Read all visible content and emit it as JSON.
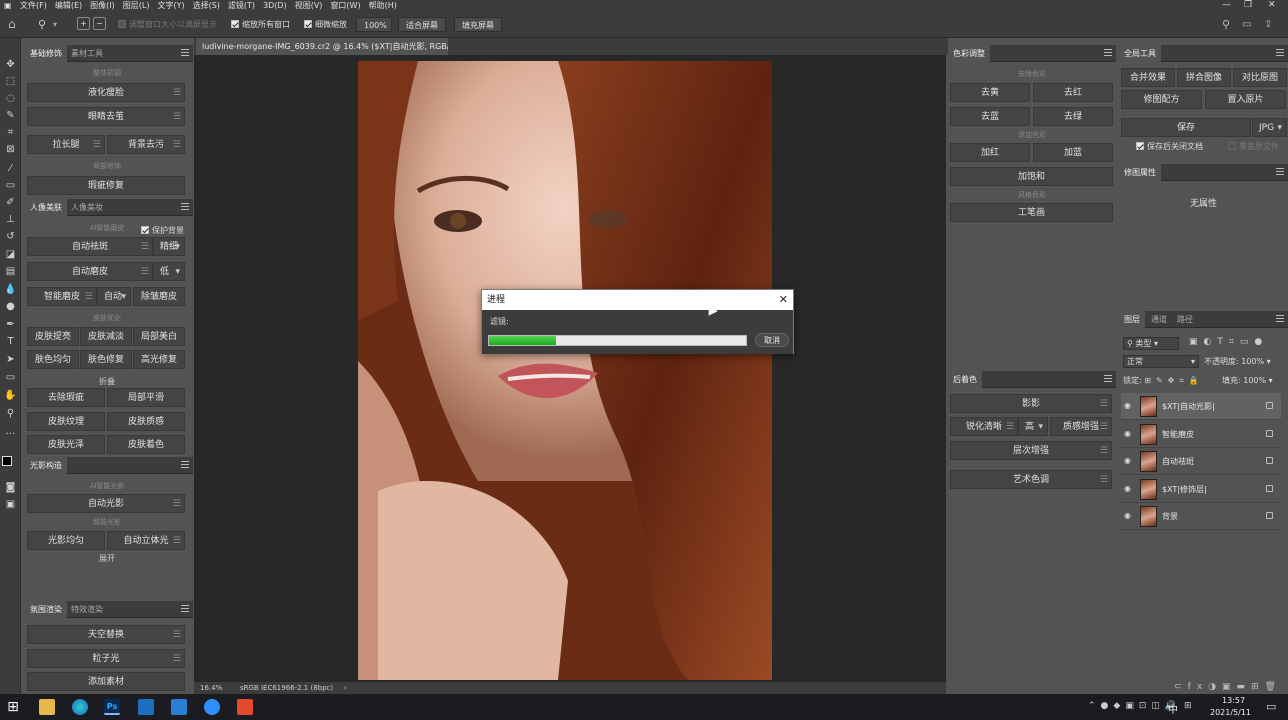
{
  "menubar": {
    "items": [
      "文件(F)",
      "编辑(E)",
      "图像(I)",
      "图层(L)",
      "文字(Y)",
      "选择(S)",
      "滤镜(T)",
      "3D(D)",
      "视图(V)",
      "窗口(W)",
      "帮助(H)"
    ],
    "window_controls": [
      "—",
      "❐",
      "✕"
    ]
  },
  "optbar": {
    "resize_windows": "调整窗口大小以满屏显示",
    "zoom_all": "缩放所有窗口",
    "scrubby_zoom": "细微缩放",
    "zoom_value": "100%",
    "fit_screen": "适合屏幕",
    "fill_screen": "填充屏幕"
  },
  "left_panel1": {
    "tabs": [
      "基础修饰",
      "素材工具"
    ],
    "sec1": "整体初调",
    "liquify": "液化瘦脸",
    "eye_bags": "眼睛去茧",
    "long_legs": "拉长腿",
    "bg_clean": "背景去污",
    "sec2": "局部修饰",
    "mole_fix": "瑕疵修复"
  },
  "left_panel2": {
    "tabs": [
      "人像美肤",
      "人像美妆"
    ],
    "sec1": "AI智能磨皮",
    "protect_bg": "保护背景",
    "auto_spot": "自动祛斑",
    "auto_spot_opt": "精细",
    "auto_smooth": "自动磨皮",
    "auto_smooth_opt": "低",
    "smart_smooth": "智能磨皮",
    "smart_opt": "自动",
    "wrinkle": "除皱磨皮",
    "sec2": "皮肤优化",
    "skin_bright": "皮肤提亮",
    "skin_dim": "皮肤减淡",
    "local_white": "局部美白",
    "even_tone": "肤色均匀",
    "tone_fix": "肤色修复",
    "highlight_fix": "高光修复",
    "collapse": "折叠",
    "remove_pores": "去除瑕疵",
    "local_smooth": "局部平滑",
    "skin_texture": "皮肤纹理",
    "skin_quality": "皮肤质感",
    "skin_gloss": "皮肤光泽",
    "skin_color": "皮肤着色"
  },
  "left_panel3": {
    "tabs": [
      "光影构造"
    ],
    "sec1": "AI智能光影",
    "auto_light": "自动光影",
    "sec2": "智能光影",
    "light_even": "光影均匀",
    "auto_3d": "自动立体光",
    "expand": "展开"
  },
  "left_panel4": {
    "tabs": [
      "氛围渲染",
      "特效渲染"
    ],
    "sky": "天空替换",
    "particles": "粒子光",
    "add_material": "添加素材"
  },
  "document": {
    "tab_title": "ludivine-morgane-IMG_6039.cr2 @ 16.4% ($XT|自动光影, RGB/8) *",
    "zoom": "16.4%",
    "profile": "sRGB IEC61966-2.1 (8bpc)"
  },
  "dialog": {
    "title": "进程",
    "label": "滤镜:",
    "progress": 0.26,
    "cancel": "取消"
  },
  "color_panel": {
    "title": "色彩调整",
    "sec1": "去除色彩",
    "go_yellow": "去黄",
    "go_red": "去红",
    "go_blue": "去蓝",
    "go_green": "去绿",
    "sec2": "添加色彩",
    "add_red": "加红",
    "add_blue": "加蓝",
    "add_sat": "加饱和",
    "sec3": "风格色彩",
    "pen": "工笔画"
  },
  "grade_panel": {
    "title": "后着色",
    "shadow": "影影",
    "sharpen": "锐化清晰",
    "sharpen_opt": "高",
    "quality": "质感增强",
    "layers_boost": "层次增强",
    "art_tone": "艺术色调"
  },
  "global_panel": {
    "title": "全局工具",
    "merge": "合并效果",
    "stitch": "拼合图像",
    "compare": "对比原图",
    "retouch": "修图配方",
    "place": "置入原片",
    "save": "保存",
    "format": "JPG",
    "close_after": "保存后关闭文档",
    "overwrite": "覆盖原文件"
  },
  "props_panel": {
    "title": "修图属性",
    "empty": "无属性"
  },
  "layers_panel": {
    "tabs": [
      "图层",
      "通道",
      "路径"
    ],
    "kind": "类型",
    "blend": "正常",
    "opacity_label": "不透明度:",
    "opacity": "100%",
    "lock_label": "锁定:",
    "fill_label": "填充:",
    "fill": "100%",
    "layers": [
      "$XT|自动光影|",
      "智能磨皮",
      "自动祛斑",
      "$XT|修饰层|",
      "背景"
    ]
  },
  "taskbar": {
    "time": "13:57",
    "date": "2021/5/11",
    "ime": "中"
  },
  "colors": {
    "ui_dark": "#3c3c3c",
    "ui_mid": "#535353",
    "progress": "#1aa91a"
  }
}
